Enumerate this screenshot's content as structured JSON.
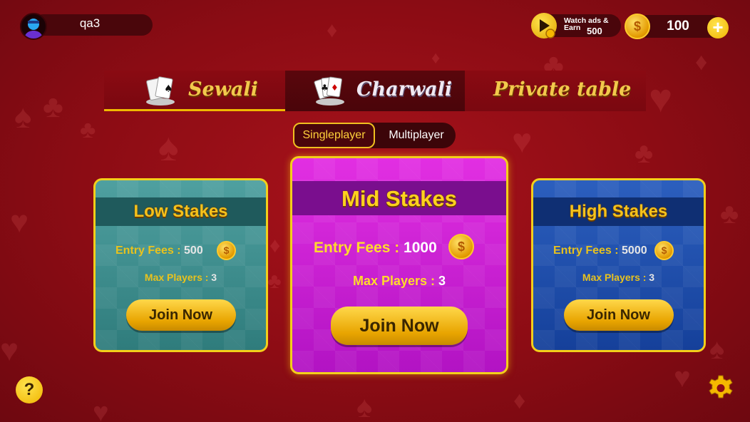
{
  "profile": {
    "username": "qa3"
  },
  "ads": {
    "label": "Watch ads & Earn",
    "reward": "500"
  },
  "wallet": {
    "coin_symbol": "$",
    "balance": "100",
    "add_symbol": "+"
  },
  "tabs": [
    {
      "label": "Sewali"
    },
    {
      "label": "Charwali",
      "active": true
    },
    {
      "label": "Private table"
    }
  ],
  "mode": {
    "single": "Singleplayer",
    "multi": "Multiplayer",
    "selected": "Singleplayer"
  },
  "tables": {
    "low": {
      "title": "Low Stakes",
      "fee_label": "Entry Fees : ",
      "fee": "500",
      "players_label": "Max Players : ",
      "players": "3",
      "button": "Join Now"
    },
    "mid": {
      "title": "Mid Stakes",
      "fee_label": "Entry Fees : ",
      "fee": "1000",
      "players_label": "Max Players : ",
      "players": "3",
      "button": "Join Now"
    },
    "high": {
      "title": "High Stakes",
      "fee_label": "Entry Fees : ",
      "fee": "5000",
      "players_label": "Max Players : ",
      "players": "3",
      "button": "Join Now"
    }
  },
  "help": {
    "symbol": "?"
  },
  "colors": {
    "background": "#8c0c14",
    "gold": "#f3cf1a",
    "low": "#3f8f90",
    "mid": "#d421d8",
    "high": "#1f4fae"
  }
}
